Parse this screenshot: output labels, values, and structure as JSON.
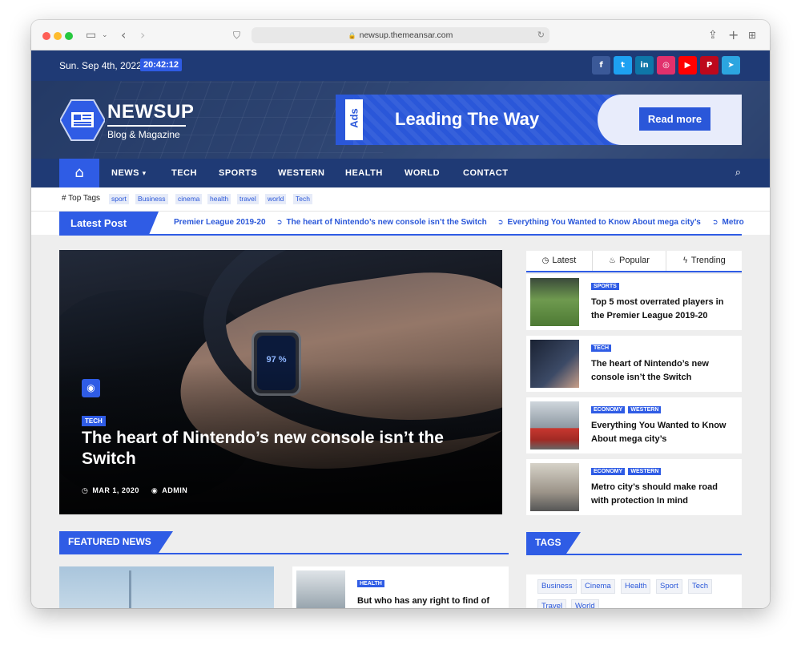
{
  "browser": {
    "url": "newsup.themeansar.com",
    "lock_icon": "lock-icon",
    "reload_icon": "reload-icon"
  },
  "topbar": {
    "date": "Sun. Sep 4th, 2022",
    "time": "20:42:12",
    "social": [
      {
        "icon": "facebook-icon",
        "glyph": "f",
        "color": "#3b5998"
      },
      {
        "icon": "twitter-icon",
        "glyph": "t",
        "color": "#1da1f2"
      },
      {
        "icon": "linkedin-icon",
        "glyph": "in",
        "color": "#0e76a8"
      },
      {
        "icon": "instagram-icon",
        "glyph": "◎",
        "color": "#e1306c"
      },
      {
        "icon": "youtube-icon",
        "glyph": "▶",
        "color": "#ff0000"
      },
      {
        "icon": "pinterest-icon",
        "glyph": "P",
        "color": "#bd081c"
      },
      {
        "icon": "telegram-icon",
        "glyph": "➤",
        "color": "#2ca5e0"
      }
    ]
  },
  "logo": {
    "title": "NEWSUP",
    "subtitle": "Blog & Magazine"
  },
  "ad": {
    "tag": "Ads",
    "title": "Leading The Way",
    "button": "Read more"
  },
  "nav": {
    "items": [
      "NEWS",
      "TECH",
      "SPORTS",
      "WESTERN",
      "HEALTH",
      "WORLD",
      "CONTACT"
    ],
    "news_caret": "▾"
  },
  "top_tags": {
    "label": "# Top Tags",
    "tags": [
      "sport",
      "Business",
      "cinema",
      "health",
      "travel",
      "world",
      "Tech"
    ]
  },
  "latest_post": {
    "label": "Latest Post",
    "items": [
      "Premier League 2019-20",
      "The heart of Nintendo’s new console isn’t the Switch",
      "Everything You Wanted to Know About mega city’s",
      "Metro"
    ]
  },
  "hero": {
    "category": "TECH",
    "title": "The heart of Nintendo’s new console isn’t the Switch",
    "date": "MAR 1, 2020",
    "author": "ADMIN",
    "watch_reading": "97 %"
  },
  "sidebar": {
    "tabs": [
      "Latest",
      "Popular",
      "Trending"
    ],
    "items": [
      {
        "cats": [
          "SPORTS"
        ],
        "title": "Top 5 most overrated players in the Premier League 2019-20"
      },
      {
        "cats": [
          "TECH"
        ],
        "title": "The heart of Nintendo’s new console isn’t the Switch"
      },
      {
        "cats": [
          "ECONOMY",
          "WESTERN"
        ],
        "title": "Everything You Wanted to Know About mega city’s"
      },
      {
        "cats": [
          "ECONOMY",
          "WESTERN"
        ],
        "title": "Metro city’s should make road with protection In mind"
      }
    ]
  },
  "featured": {
    "heading": "FEATURED NEWS",
    "card": {
      "category": "HEALTH",
      "title": "But who has any right to find of"
    }
  },
  "tags_widget": {
    "heading": "TAGS",
    "tags": [
      "Business",
      "Cinema",
      "Health",
      "Sport",
      "Tech",
      "Travel",
      "World"
    ]
  },
  "colors": {
    "primary": "#2f5ce5",
    "navy": "#1f3a75"
  }
}
